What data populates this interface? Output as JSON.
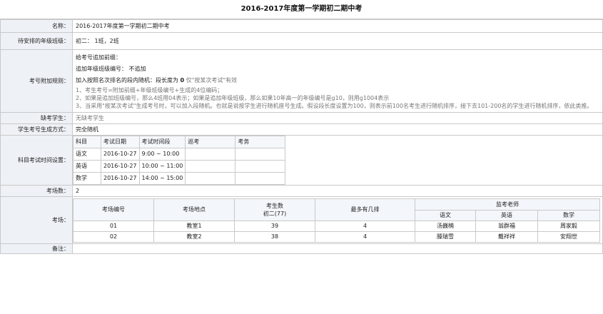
{
  "page": {
    "title": "2016-2017年度第一学期初二期中考"
  },
  "rows": {
    "name": {
      "label": "名称：",
      "value": "2016-2017年度第一学期初二期中考"
    },
    "classes": {
      "label": "待安排的年级班级：",
      "value": "初二： 1班，2班"
    },
    "rules": {
      "label": "考号附加规则：",
      "prefix": "给考号追加前缀：",
      "append_code_label": "追加年级班级编号：",
      "append_code_value": "不追加",
      "random_label": "加入按照名次排名的段内随机：段长度为",
      "random_value": "0",
      "random_note": "仅\"按某次考试\"有效",
      "hints": [
        "1、考生考号=附加前缀+年级班级编号+生成的4位编码；",
        "2、如果是追加班级编号，那么4班用04表示；如果是追加年级班级，那么如果10年高一的年级编号是g10，则用g1004表示",
        "3、当采用\"按某次考试\"生成考号时，可以加入段随机。也就是说按学生进行随机座号生成。假设段长度设置为100，则表示前100名考生进行随机排序，接下去101-200名的学生进行随机排序，依此类推。"
      ]
    },
    "absent": {
      "label": "缺考学生：",
      "value": "无缺考学生"
    },
    "number_mode": {
      "label": "学生考号生成方式：",
      "value": "完全随机"
    },
    "schedule": {
      "label": "科目考试时间设置：",
      "headers": [
        "科目",
        "考试日期",
        "考试时间段",
        "巡考",
        "考务"
      ],
      "rows": [
        {
          "subject": "语文",
          "date": "2016-10-27",
          "time": "9:00 ~ 10:00",
          "patrol": "",
          "affairs": ""
        },
        {
          "subject": "英语",
          "date": "2016-10-27",
          "time": "10:00 ~ 11:00",
          "patrol": "",
          "affairs": ""
        },
        {
          "subject": "数学",
          "date": "2016-10-27",
          "time": "14:00 ~ 15:00",
          "patrol": "",
          "affairs": ""
        }
      ]
    },
    "room_count": {
      "label": "考场数：",
      "value": "2"
    },
    "rooms": {
      "label": "考场：",
      "headers": {
        "code": "考场编号",
        "place": "考场地点",
        "count_title": "考生数",
        "count_sub": "初二(77)",
        "max_rank": "最多有几排",
        "proctors": "监考老师",
        "subjects": [
          "语文",
          "英语",
          "数学"
        ]
      },
      "rows": [
        {
          "code": "01",
          "place": "教室1",
          "count": "39",
          "max_rank": "4",
          "proctors": [
            "汤巍楠",
            "翁群福",
            "周家毅"
          ]
        },
        {
          "code": "02",
          "place": "教室2",
          "count": "38",
          "max_rank": "4",
          "proctors": [
            "滕瑞雪",
            "戴祥祥",
            "安翔世"
          ]
        }
      ]
    },
    "remark": {
      "label": "备注：",
      "value": ""
    }
  }
}
